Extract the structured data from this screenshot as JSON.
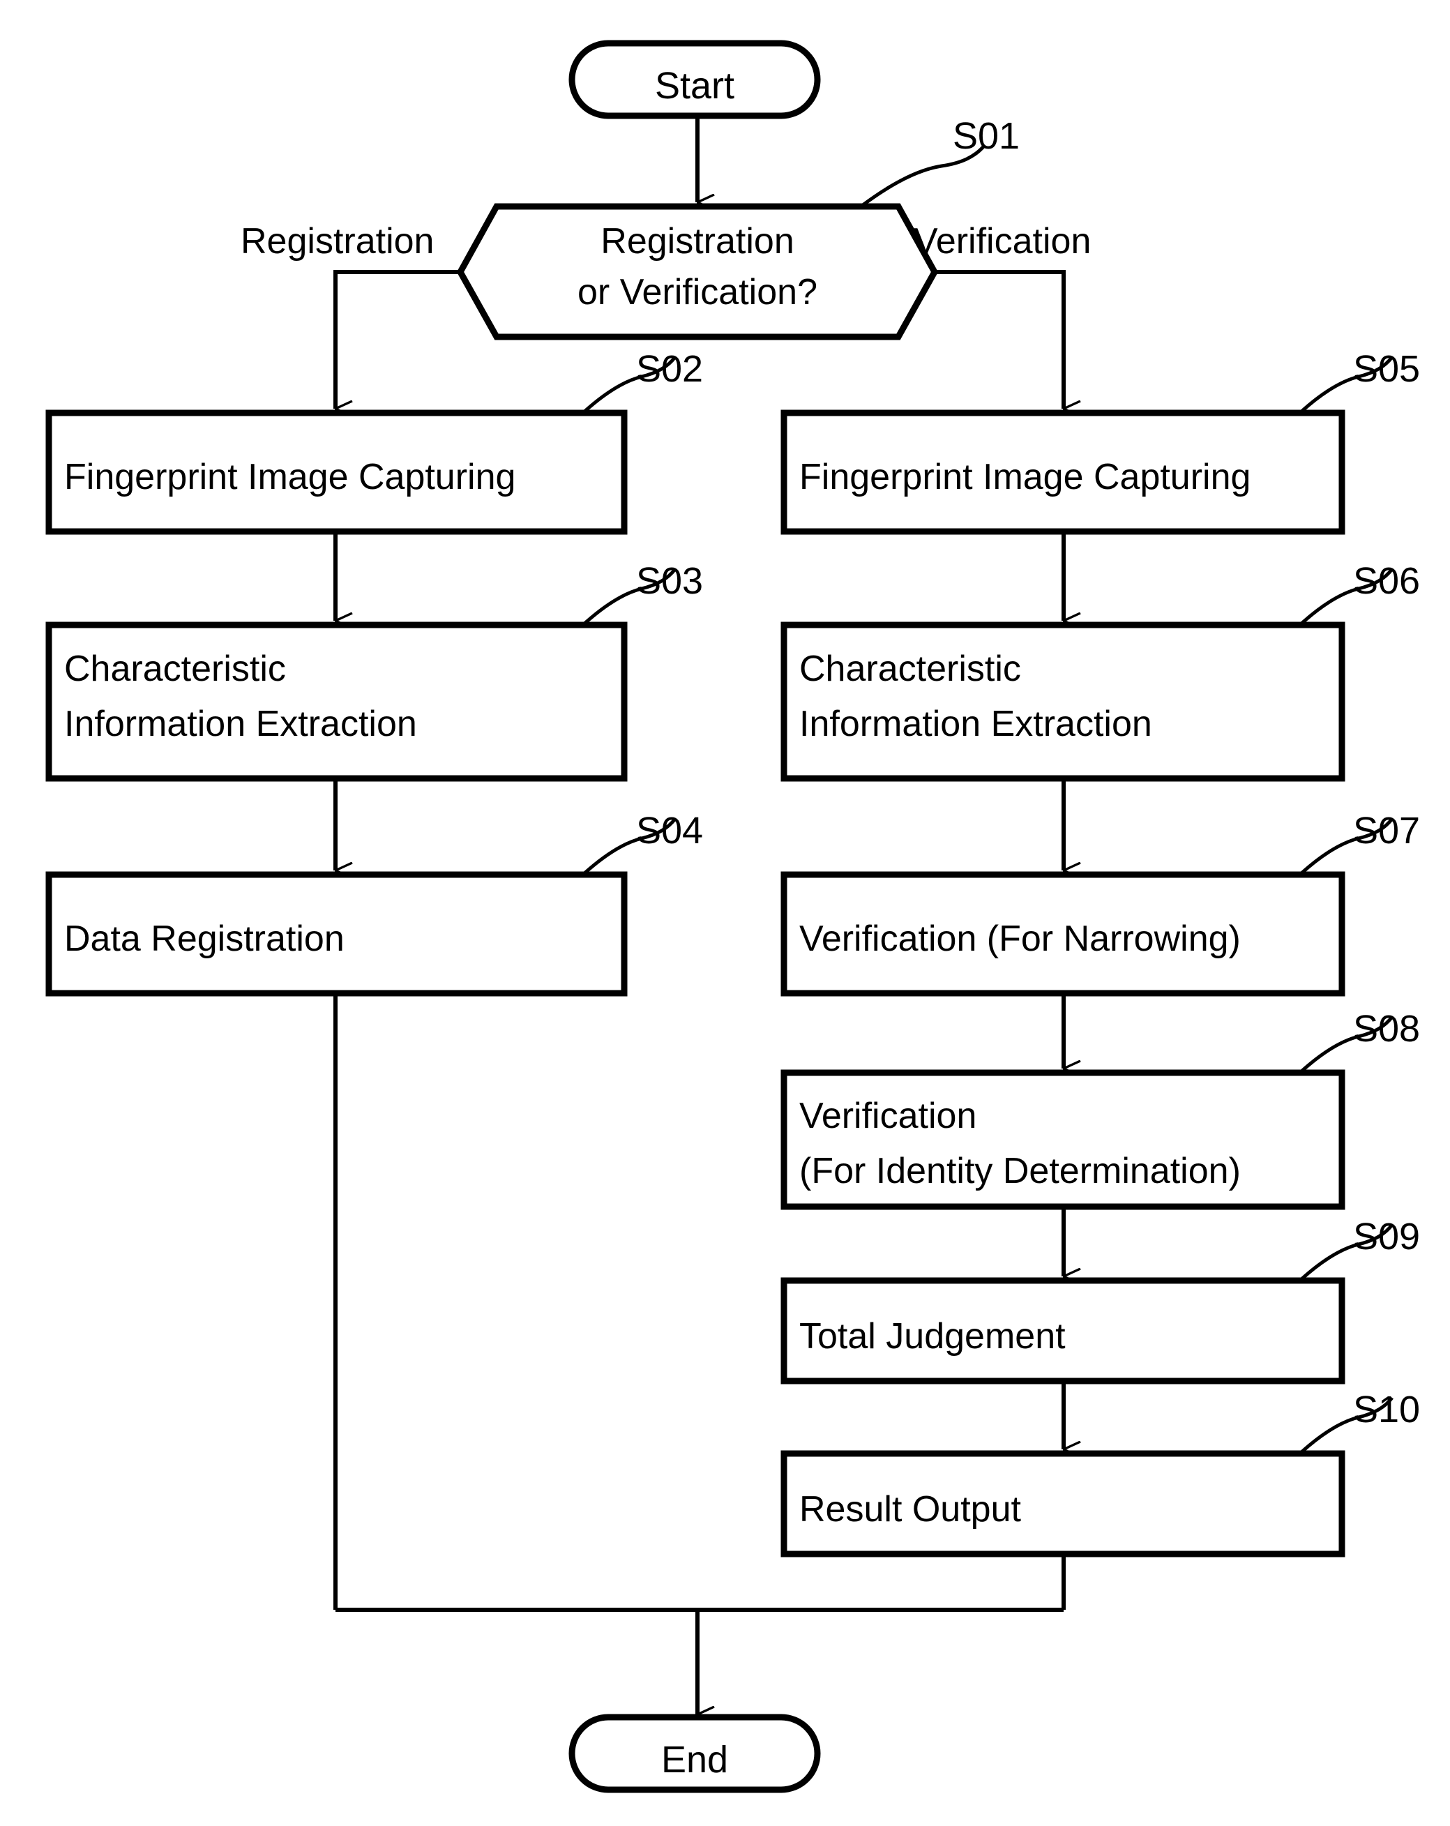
{
  "diagram": {
    "title": "Fingerprint Registration and Verification Flowchart",
    "stroke_color": "#000000",
    "fill_color": "#ffffff",
    "background": "#ffffff"
  },
  "terminals": {
    "start": "Start",
    "end": "End"
  },
  "decision": {
    "line1": "Registration",
    "line2": "or Verification?",
    "step_id": "S01",
    "branch_left": "Registration",
    "branch_right": "Verification"
  },
  "registration_branch": [
    {
      "step_id": "S02",
      "label": "Fingerprint Image Capturing"
    },
    {
      "step_id": "S03",
      "label_line1": "Characteristic",
      "label_line2": "Information Extraction"
    },
    {
      "step_id": "S04",
      "label": "Data Registration"
    }
  ],
  "verification_branch": [
    {
      "step_id": "S05",
      "label": "Fingerprint Image Capturing"
    },
    {
      "step_id": "S06",
      "label_line1": "Characteristic",
      "label_line2": "Information Extraction"
    },
    {
      "step_id": "S07",
      "label": "Verification (For Narrowing)"
    },
    {
      "step_id": "S08",
      "label_line1": "Verification",
      "label_line2": "(For Identity Determination)"
    },
    {
      "step_id": "S09",
      "label": "Total Judgement"
    },
    {
      "step_id": "S10",
      "label": "Result Output"
    }
  ],
  "chart_data": {
    "type": "diagram",
    "diagram_type": "flowchart",
    "orientation": "top-to-bottom",
    "nodes": [
      {
        "id": "start",
        "shape": "stadium",
        "text": "Start"
      },
      {
        "id": "S01",
        "shape": "hexagon",
        "text": "Registration or Verification?"
      },
      {
        "id": "S02",
        "shape": "rectangle",
        "text": "Fingerprint Image Capturing"
      },
      {
        "id": "S03",
        "shape": "rectangle",
        "text": "Characteristic Information Extraction"
      },
      {
        "id": "S04",
        "shape": "rectangle",
        "text": "Data Registration"
      },
      {
        "id": "S05",
        "shape": "rectangle",
        "text": "Fingerprint Image Capturing"
      },
      {
        "id": "S06",
        "shape": "rectangle",
        "text": "Characteristic Information Extraction"
      },
      {
        "id": "S07",
        "shape": "rectangle",
        "text": "Verification (For Narrowing)"
      },
      {
        "id": "S08",
        "shape": "rectangle",
        "text": "Verification (For Identity Determination)"
      },
      {
        "id": "S09",
        "shape": "rectangle",
        "text": "Total Judgement"
      },
      {
        "id": "S10",
        "shape": "rectangle",
        "text": "Result Output"
      },
      {
        "id": "end",
        "shape": "stadium",
        "text": "End"
      }
    ],
    "edges": [
      {
        "from": "start",
        "to": "S01",
        "label": ""
      },
      {
        "from": "S01",
        "to": "S02",
        "label": "Registration"
      },
      {
        "from": "S01",
        "to": "S05",
        "label": "Verification"
      },
      {
        "from": "S02",
        "to": "S03",
        "label": ""
      },
      {
        "from": "S03",
        "to": "S04",
        "label": ""
      },
      {
        "from": "S04",
        "to": "end",
        "label": ""
      },
      {
        "from": "S05",
        "to": "S06",
        "label": ""
      },
      {
        "from": "S06",
        "to": "S07",
        "label": ""
      },
      {
        "from": "S07",
        "to": "S08",
        "label": ""
      },
      {
        "from": "S08",
        "to": "S09",
        "label": ""
      },
      {
        "from": "S09",
        "to": "S10",
        "label": ""
      },
      {
        "from": "S10",
        "to": "end",
        "label": ""
      }
    ]
  }
}
